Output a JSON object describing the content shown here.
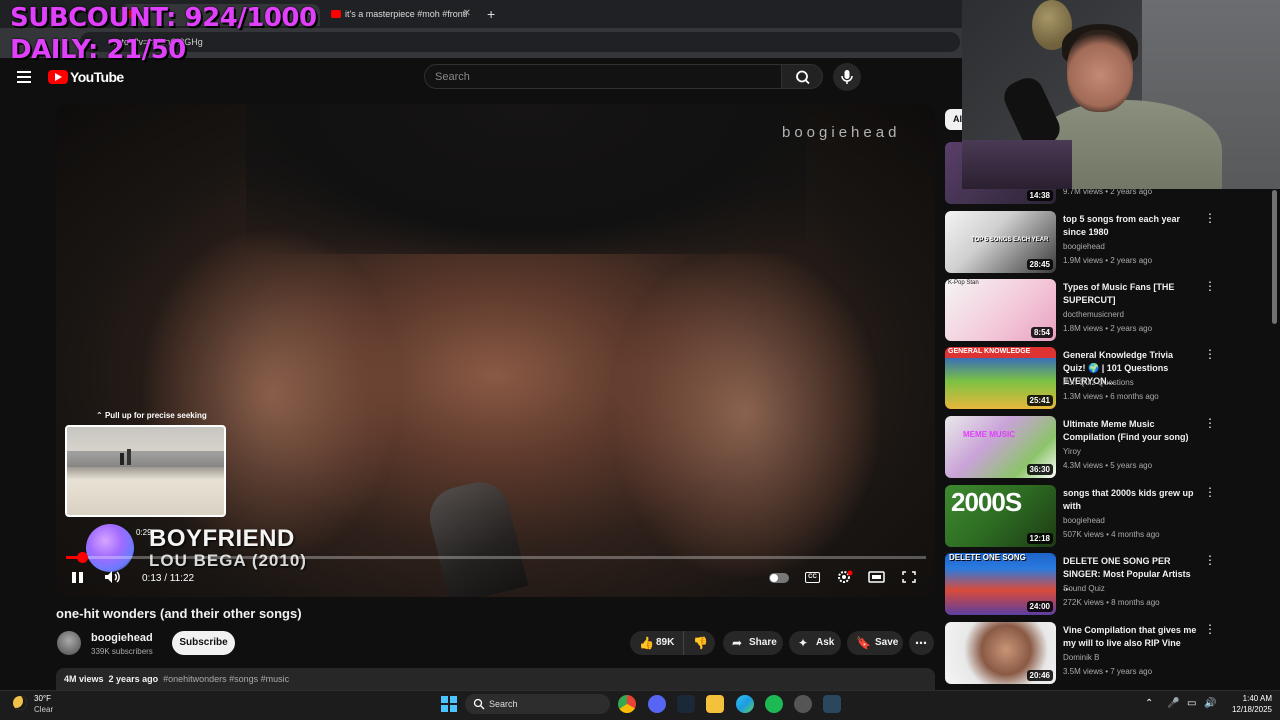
{
  "overlay": {
    "subcount": "SUBCOUNT: 924/1000",
    "daily": "DAILY: 21/50"
  },
  "browser": {
    "tabs": [
      {
        "title": "",
        "active": true
      },
      {
        "title": "it's a masterpiece #moh #frontl",
        "active": false
      }
    ],
    "url": "watch?v=bLjLnQl2GHg"
  },
  "header": {
    "logo_text": "YouTube",
    "search_placeholder": "Search"
  },
  "player": {
    "watermark": "boogiehead",
    "seek_hint": "Pull up for precise seeking",
    "seek_preview_time": "0:29",
    "song_title": "BOYFRIEND",
    "song_artist": "LOU BEGA (2010)",
    "current_time": "0:13",
    "duration": "11:22",
    "time_display": "0:13 / 11:22",
    "progress_fraction": 0.019
  },
  "video": {
    "title": "one-hit wonders (and their other songs)",
    "channel": "boogiehead",
    "subscribers": "339K subscribers",
    "subscribe_label": "Subscribe",
    "likes": "89K",
    "share_label": "Share",
    "ask_label": "Ask",
    "save_label": "Save",
    "views": "4M views",
    "age": "2 years ago",
    "tags": "#onehitwonders #songs #music"
  },
  "sidebar": {
    "chip_all": "Al",
    "items": [
      {
        "title": "",
        "channel": "",
        "stats": "9.7M views • 2 years ago",
        "duration": "14:38"
      },
      {
        "title": "top 5 songs from each year since 1980",
        "channel": "boogiehead",
        "stats": "1.9M views • 2 years ago",
        "duration": "28:45"
      },
      {
        "title": "Types of Music Fans [THE SUPERCUT]",
        "channel": "docthemusicnerd",
        "stats": "1.8M views • 2 years ago",
        "duration": "8:54"
      },
      {
        "title": "General Knowledge Trivia Quiz! 🌍 | 101 Questions EVERYON...",
        "channel": "Fun Quiz Questions",
        "stats": "1.3M views • 6 months ago",
        "duration": "25:41"
      },
      {
        "title": "Ultimate Meme Music Compilation (Find your song)",
        "channel": "Yiroy",
        "stats": "4.3M views • 5 years ago",
        "duration": "36:30"
      },
      {
        "title": "songs that 2000s kids grew up with",
        "channel": "boogiehead",
        "stats": "507K views • 4 months ago",
        "duration": "12:18"
      },
      {
        "title": "DELETE ONE SONG PER SINGER: Most Popular Artists ...",
        "channel": "Sound Quiz",
        "stats": "272K views • 8 months ago",
        "duration": "24:00"
      },
      {
        "title": "Vine Compilation that gives me my will to live also RIP Vine",
        "channel": "Dominik B",
        "stats": "3.5M views • 7 years ago",
        "duration": "20:46"
      }
    ],
    "thumb_texts": [
      "",
      "TOP 5 SONGS EACH YEAR",
      "K-Pop Stan",
      "GENERAL KNOWLEDGE",
      "MEME MUSIC",
      "2000S",
      "DELETE ONE SONG",
      ""
    ]
  },
  "taskbar": {
    "temp": "30°F",
    "condition": "Clear",
    "search_label": "Search",
    "time": "1:40 AM",
    "date": "12/18/2025"
  }
}
